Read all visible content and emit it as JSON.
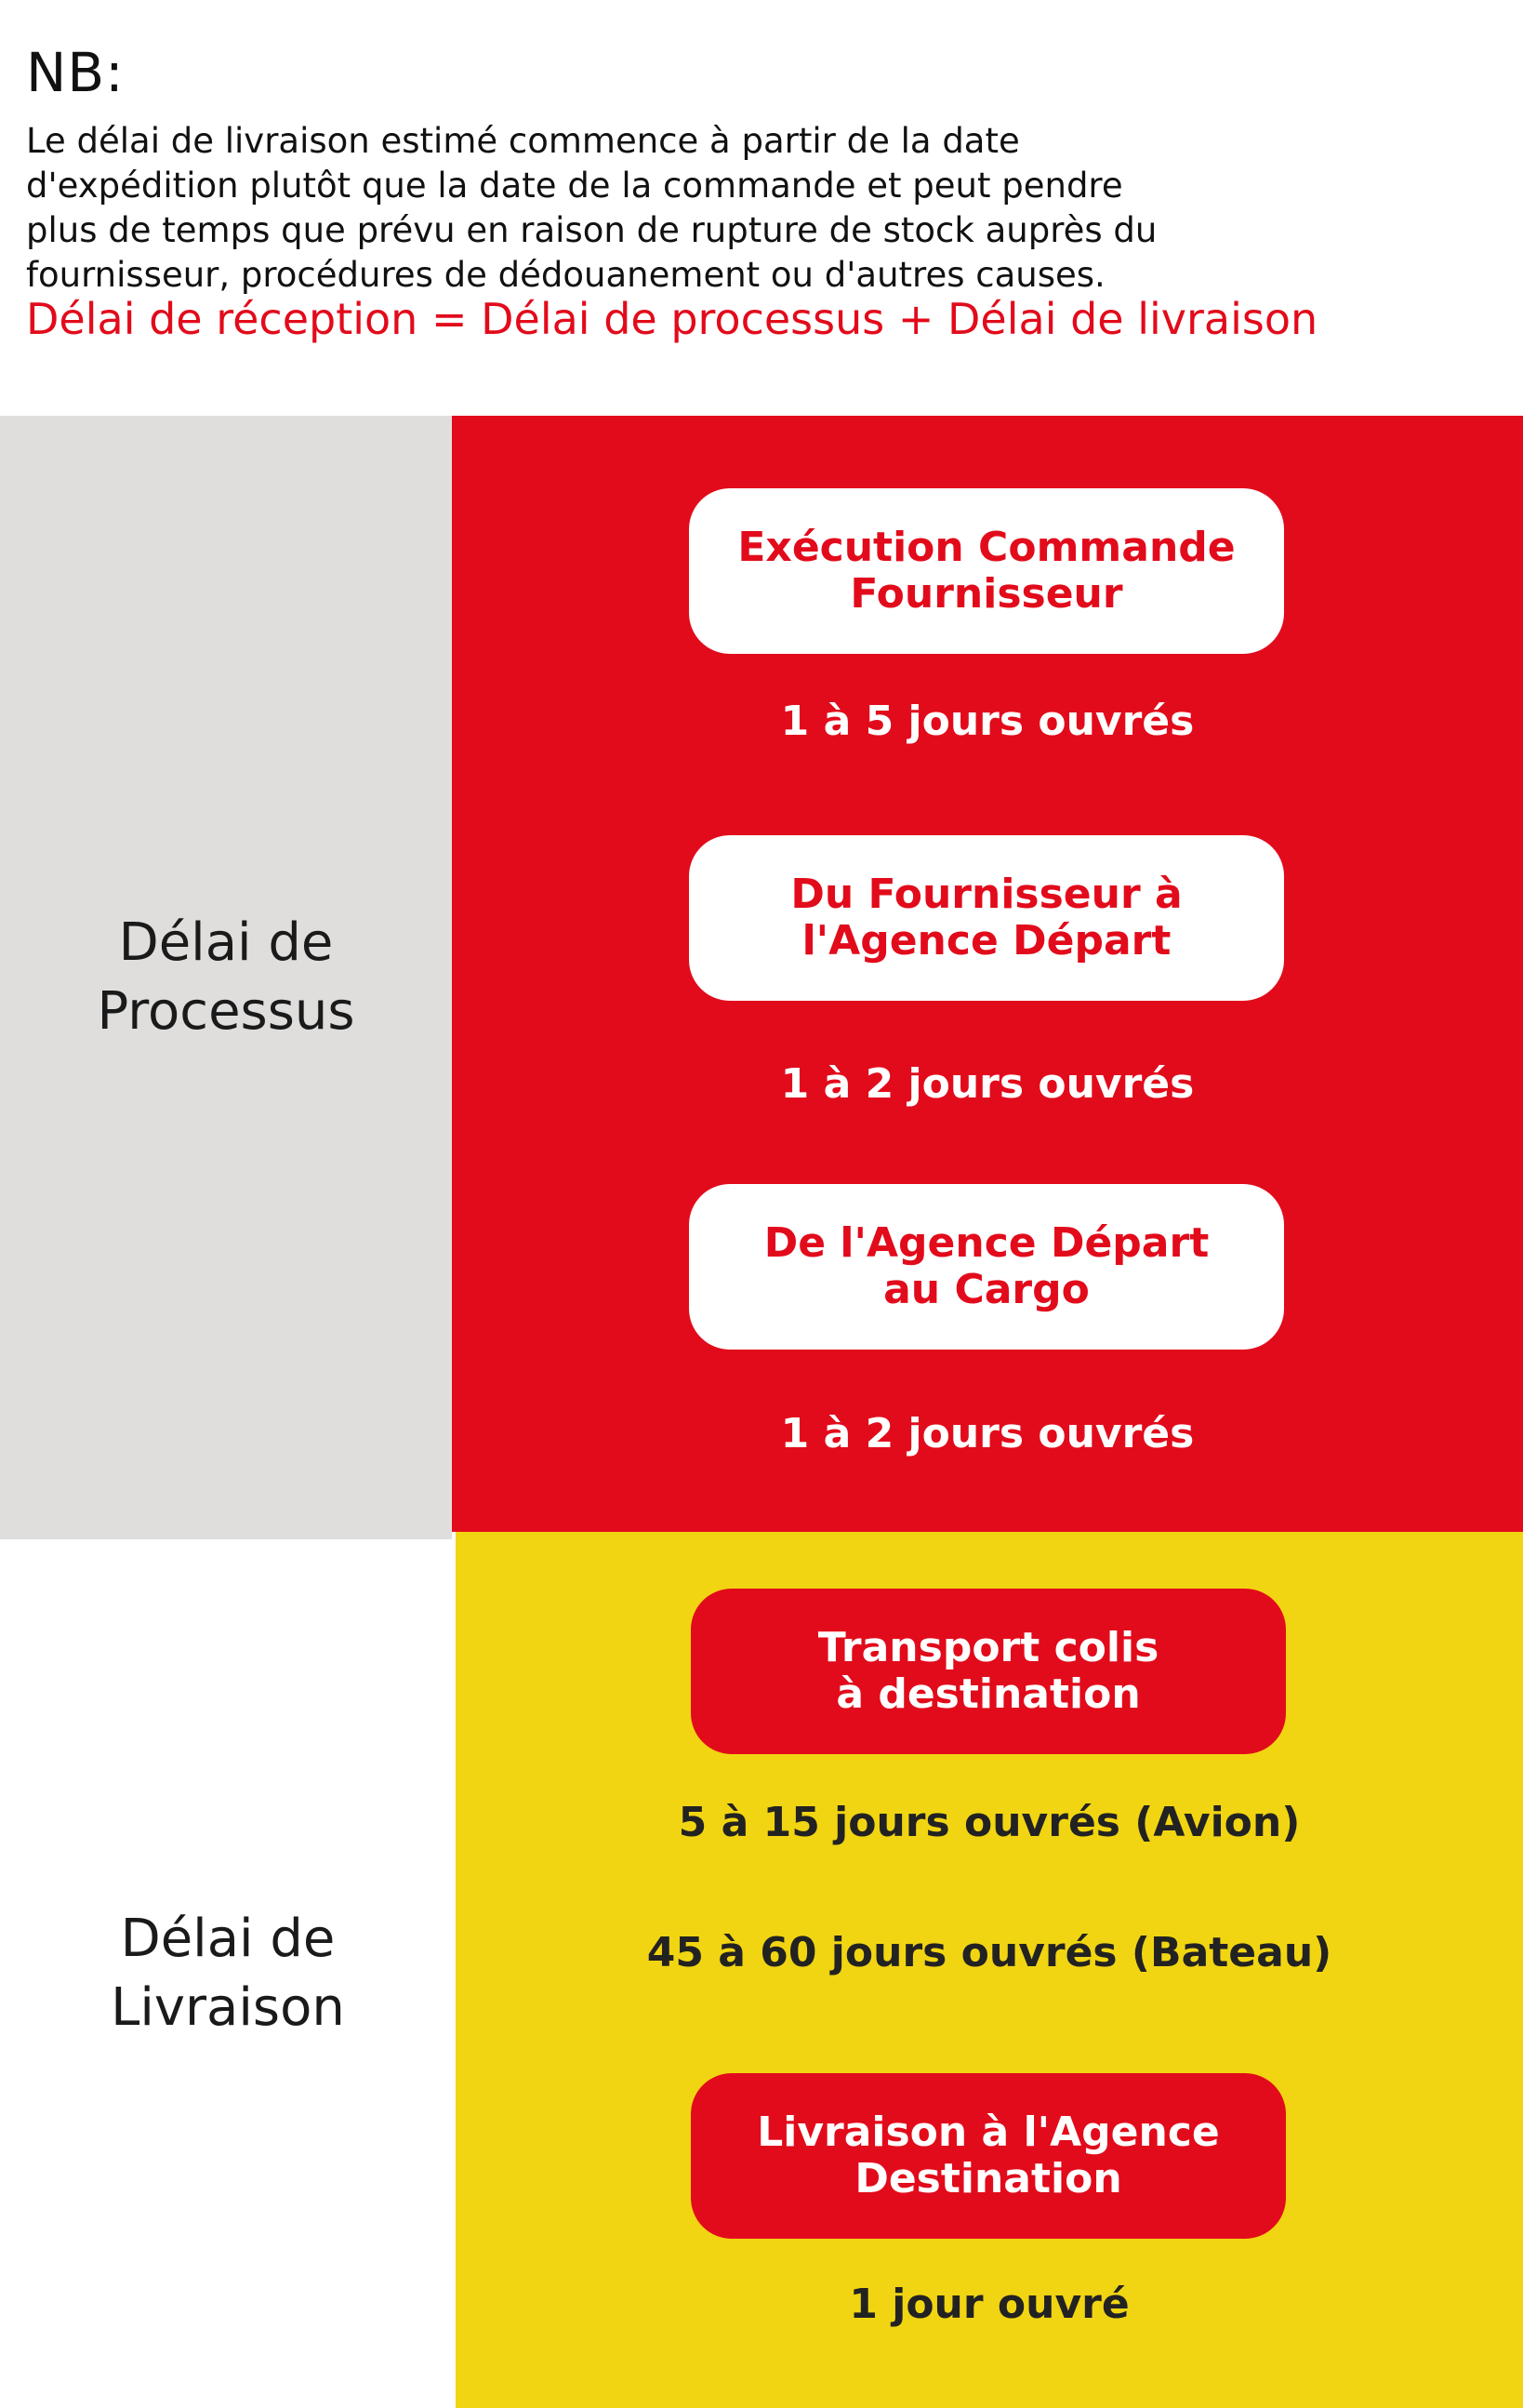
{
  "note": {
    "title": "NB:",
    "text_lines": [
      "Le délai de livraison estimé commence à partir de la date",
      "d'expédition plutôt que la date de la commande et peut pendre",
      "plus de temps que prévu en raison de rupture de stock auprès du",
      "fournisseur, procédures de dédouanement ou d'autres causes."
    ],
    "formula": "Délai de réception = Délai de processus + Délai de livraison"
  },
  "process_section": {
    "label_lines": [
      "Délai de",
      "Processus"
    ],
    "steps": [
      {
        "title_lines": [
          "Exécution Commande",
          "Fournisseur"
        ],
        "duration": "1 à 5 jours ouvrés"
      },
      {
        "title_lines": [
          "Du Fournisseur à",
          "l'Agence Départ"
        ],
        "duration": "1 à 2 jours ouvrés"
      },
      {
        "title_lines": [
          "De l'Agence Départ",
          "au Cargo"
        ],
        "duration": "1 à 2 jours ouvrés"
      }
    ]
  },
  "delivery_section": {
    "label_lines": [
      "Délai de",
      "Livraison"
    ],
    "steps": [
      {
        "title_lines": [
          "Transport colis",
          "à destination"
        ],
        "durations": [
          "5 à 15 jours ouvrés (Avion)",
          "45 à 60 jours ouvrés (Bateau)"
        ]
      },
      {
        "title_lines": [
          "Livraison à l'Agence",
          "Destination"
        ],
        "durations": [
          "1 jour ouvré"
        ]
      }
    ]
  },
  "colors": {
    "red": "#e20b1b",
    "yellow": "#f1d512",
    "gray": "#e0dedd",
    "white": "#ffffff",
    "dark_text": "#222222"
  }
}
